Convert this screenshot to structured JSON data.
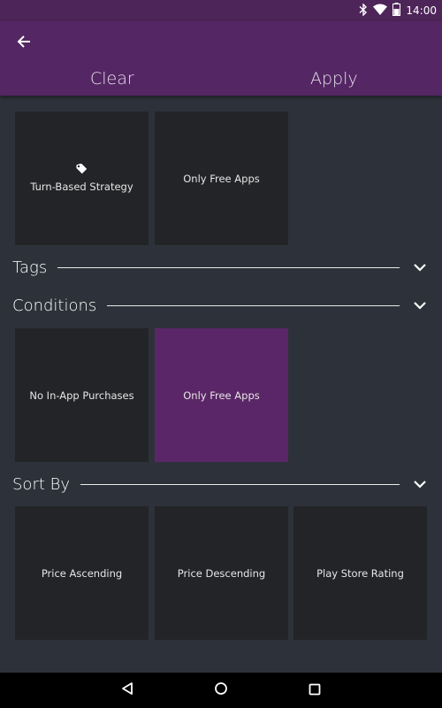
{
  "status_bar": {
    "time": "14:00",
    "icons": [
      "bluetooth-icon",
      "wifi-icon",
      "battery-icon"
    ]
  },
  "toolbar": {
    "back_icon": "arrow-left-icon",
    "clear_label": "Clear",
    "apply_label": "Apply"
  },
  "top_tiles": [
    {
      "label": "Turn-Based Strategy",
      "icon": "tag-icon",
      "selected": false
    },
    {
      "label": "Only Free Apps",
      "selected": false
    }
  ],
  "sections": {
    "tags": {
      "label": "Tags",
      "icon": "chevron-down-icon"
    },
    "conditions": {
      "label": "Conditions",
      "icon": "chevron-down-icon",
      "tiles": [
        {
          "label": "No In-App Purchases",
          "selected": false
        },
        {
          "label": "Only Free Apps",
          "selected": true
        }
      ]
    },
    "sort_by": {
      "label": "Sort By",
      "icon": "chevron-down-icon",
      "tiles": [
        {
          "label": "Price Ascending",
          "selected": false
        },
        {
          "label": "Price Descending",
          "selected": false
        },
        {
          "label": "Play Store Rating",
          "selected": false
        }
      ]
    }
  },
  "nav_bar": {
    "icons": [
      "back-triangle-icon",
      "home-circle-icon",
      "recents-square-icon"
    ]
  },
  "colors": {
    "primary": "#542663",
    "background": "#2d323a",
    "tile": "#232427",
    "selected_tile": "#5a2667"
  }
}
